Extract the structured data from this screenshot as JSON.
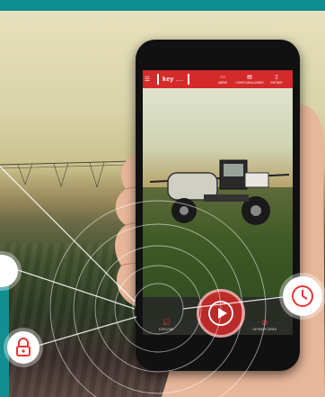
{
  "app": {
    "logo": {
      "text_main": "key",
      "text_dim": "...."
    },
    "top_actions": [
      {
        "icon": "folder-icon",
        "label": "ABRIR"
      },
      {
        "icon": "document-icon",
        "label": "CONFIGURACIONES"
      },
      {
        "icon": "phone-icon",
        "label": "ENTRAR"
      }
    ],
    "bottom_actions": [
      {
        "icon": "check-box-icon",
        "label": "EJECUTAR"
      },
      {
        "icon": "stop-icon",
        "label": "DETENER TAREA"
      }
    ]
  },
  "colors": {
    "accent": "#d42a2a",
    "teal": "#0e8d8f"
  },
  "decor_icons": [
    "clock-icon",
    "lock-icon",
    "play-icon"
  ]
}
